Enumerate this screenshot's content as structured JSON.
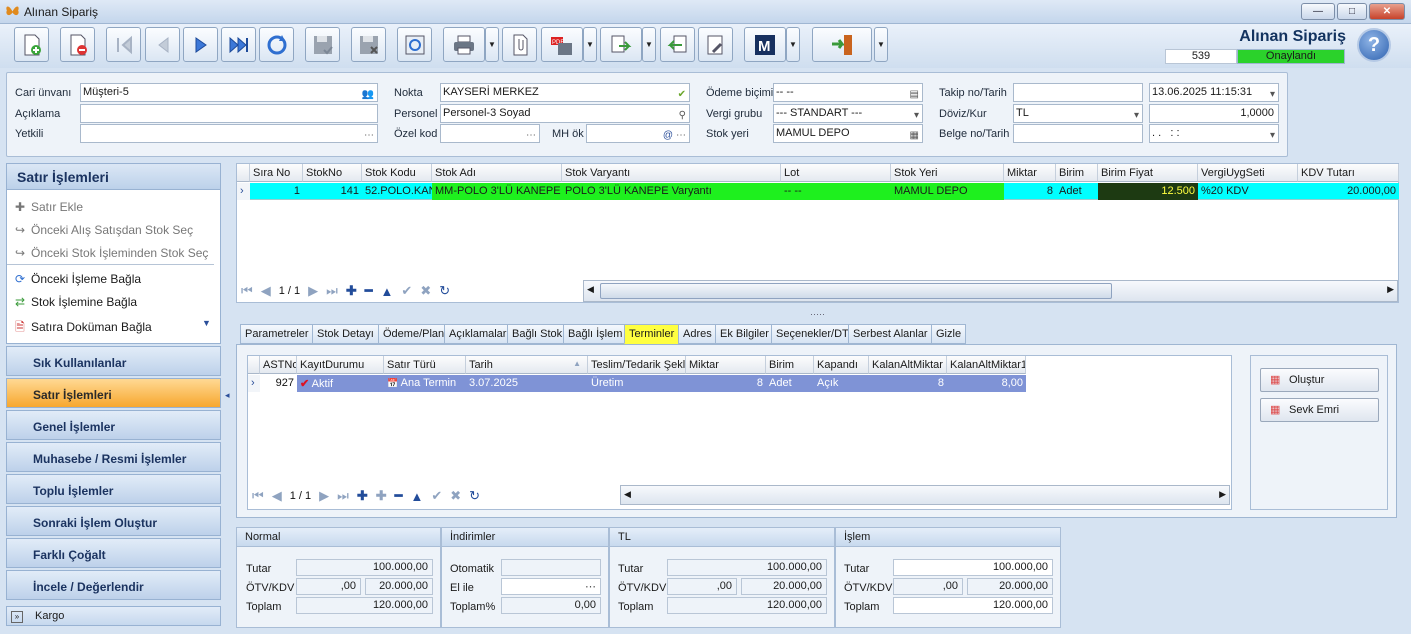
{
  "window": {
    "title": "Alınan Sipariş",
    "min": "—",
    "max": "□",
    "close": "✕"
  },
  "doc": {
    "title": "Alınan Sipariş",
    "number": "539",
    "status": "Onaylandı",
    "help": "?"
  },
  "header": {
    "cari_label": "Cari ünvanı",
    "cari_value": "Müşteri-5",
    "aciklama_label": "Açıklama",
    "aciklama_value": "",
    "yetkili_label": "Yetkili",
    "yetkili_value": "",
    "nokta_label": "Nokta",
    "nokta_value": "KAYSERİ MERKEZ",
    "personel_label": "Personel",
    "personel_value": "Personel-3 Soyad",
    "ozelkod_label": "Özel kod",
    "ozelkod_value": "",
    "mhok_label": "MH ök",
    "mhok_value": "",
    "odeme_label": "Ödeme biçimi",
    "odeme_value": "-- --",
    "vergi_label": "Vergi grubu",
    "vergi_value": "--- STANDART ---",
    "stokyeri_label": "Stok yeri",
    "stokyeri_value": "MAMUL DEPO",
    "takip_label": "Takip no/Tarih",
    "takip_value": "",
    "takip_date": "13.06.2025 11:15:31",
    "doviz_label": "Döviz/Kur",
    "doviz_value": "TL",
    "kur_value": "1,0000",
    "belge_label": "Belge no/Tarih",
    "belge_value": "",
    "belge_date": ". .   : :"
  },
  "left": {
    "head": "Satır İşlemleri",
    "actions": [
      {
        "label": "Satır Ekle",
        "icon": "plus-icon",
        "enabled": false
      },
      {
        "label": "Önceki Alış Satışdan Stok Seç",
        "icon": "redo-arrow-icon",
        "enabled": false
      },
      {
        "label": "Önceki Stok İşleminden Stok Seç",
        "icon": "redo-arrow-icon",
        "enabled": false
      },
      {
        "label": "Önceki İşleme Bağla",
        "icon": "link-globe-icon",
        "enabled": true
      },
      {
        "label": "Stok İşlemine Bağla",
        "icon": "link-arrows-icon",
        "enabled": true
      },
      {
        "label": "Satıra Doküman Bağla",
        "icon": "document-icon",
        "enabled": true
      }
    ],
    "nav": [
      "Sık Kullanılanlar",
      "Satır İşlemleri",
      "Genel İşlemler",
      "Muhasebe / Resmi İşlemler",
      "Toplu İşlemler",
      "Sonraki İşlem Oluştur",
      "Farklı Çoğalt",
      "İncele / Değerlendir"
    ],
    "kargo": "Kargo"
  },
  "grid": {
    "columns": [
      "Sıra No",
      "StokNo",
      "Stok Kodu",
      "Stok Adı",
      "Stok Varyantı",
      "Lot",
      "Stok Yeri",
      "Miktar",
      "Birim",
      "Birim Fiyat",
      "VergiUygSeti",
      "KDV Tutarı"
    ],
    "row": {
      "sira": "1",
      "stokno": "141",
      "kod": "52.POLO.KAN",
      "ad": "MM-POLO 3'LÜ KANEPE",
      "varyant": "POLO 3'LÜ KANEPE Varyantı",
      "lot": "-- --",
      "yer": "MAMUL DEPO",
      "miktar": "8",
      "birim": "Adet",
      "fiyat": "12.500",
      "vergi": "%20 KDV",
      "kdv": "20.000,00"
    },
    "page": "1 / 1"
  },
  "tabs": [
    "Parametreler",
    "Stok Detayı",
    "Ödeme/Plan",
    "Açıklamalar",
    "Bağlı Stok",
    "Bağlı İşlem",
    "Terminler",
    "Adres",
    "Ek Bilgiler",
    "Seçenekler/DT",
    "Serbest Alanlar",
    "Gizle"
  ],
  "selected_tab": "Terminler",
  "terms": {
    "columns": [
      "ASTNo",
      "KayıtDurumu",
      "Satır Türü",
      "Tarih",
      "Teslim/Tedarik Şekli",
      "Miktar",
      "Birim",
      "Kapandı",
      "KalanAltMiktar",
      "KalanAltMiktar1"
    ],
    "row": {
      "astno": "927",
      "durum": "Aktif",
      "tur": "Ana Termin",
      "tarih": "3.07.2025",
      "teslim": "Üretim",
      "miktar": "8",
      "birim": "Adet",
      "kapandi": "Açık",
      "kalan": "8",
      "kalan1": "8,00"
    },
    "page": "1 / 1",
    "btn_olustur": "Oluştur",
    "btn_sevk": "Sevk Emri"
  },
  "sums": {
    "normal": {
      "head": "Normal",
      "tutar_label": "Tutar",
      "tutar": "100.000,00",
      "otv_label": "ÖTV/KDV",
      "otv": ",00",
      "kdv": "20.000,00",
      "toplam_label": "Toplam",
      "toplam": "120.000,00"
    },
    "indirim": {
      "head": "İndirimler",
      "oto_label": "Otomatik",
      "oto": "",
      "elile_label": "El ile",
      "elile": "",
      "toplam_label": "Toplam%",
      "toplam": "0,00"
    },
    "tl": {
      "head": "TL",
      "tutar_label": "Tutar",
      "tutar": "100.000,00",
      "otv_label": "ÖTV/KDV",
      "otv": ",00",
      "kdv": "20.000,00",
      "toplam_label": "Toplam",
      "toplam": "120.000,00"
    },
    "islem": {
      "head": "İşlem",
      "tutar_label": "Tutar",
      "tutar": "100.000,00",
      "otv_label": "ÖTV/KDV",
      "otv": ",00",
      "kdv": "20.000,00",
      "toplam_label": "Toplam",
      "toplam": "120.000,00"
    }
  }
}
